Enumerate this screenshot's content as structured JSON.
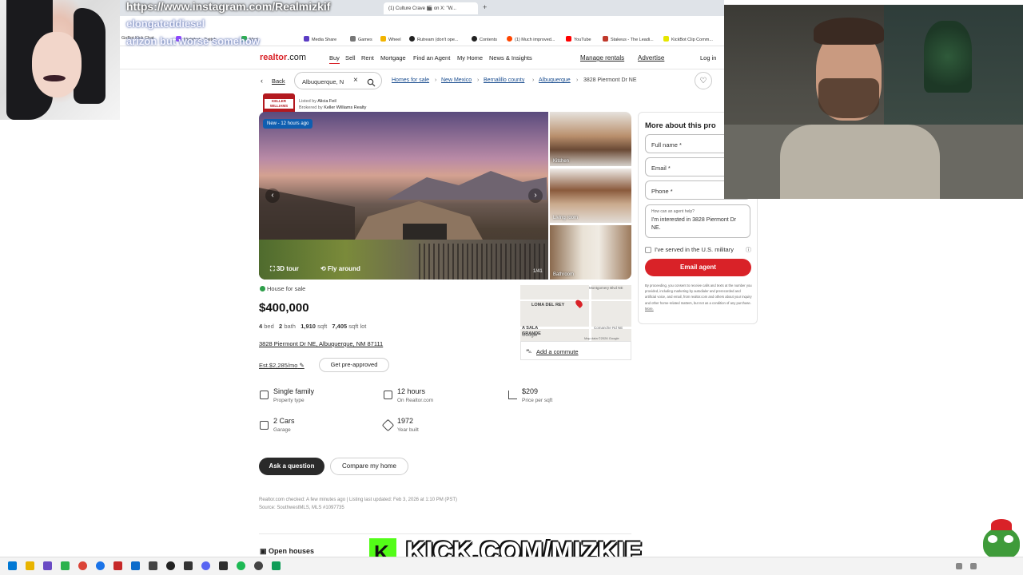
{
  "stream_overlay": {
    "url_text": "https://www.instagram.com/Realmizkif",
    "line2": "elongateddiesel",
    "line3": "arizon but worse somehow",
    "kick_text": "KICK.COM/MIZKIF"
  },
  "browser": {
    "tabs": [
      "(1) Culture Crave 🎬 on X: \"W..."
    ],
    "new_tab": "+",
    "bookmarks": [
      "GoBot Kick Chat",
      "Nightbot - Twitch",
      "Mod",
      "Media Share",
      "Games",
      "Wheel",
      "Rutream (don't ope...",
      "Contents",
      "(1) Much improved...",
      "YouTube",
      "Stakeus - The Leadi...",
      "KickBot Clip Comm..."
    ]
  },
  "header": {
    "logo_text": "realtor",
    "logo_suffix": ".com",
    "nav": [
      "Buy",
      "Sell",
      "Rent",
      "Mortgage",
      "Find an Agent",
      "My Home",
      "News & Insights"
    ],
    "manage_rentals": "Manage rentals",
    "advertise": "Advertise",
    "login": "Log in"
  },
  "search": {
    "back": "Back",
    "value": "Albuquerque, N",
    "breadcrumbs": [
      "Homes for sale",
      "New Mexico",
      "Bernalillo county",
      "Albuquerque"
    ],
    "current": "3828 Piermont Dr NE"
  },
  "agent": {
    "listed_by_label": "Listed by",
    "listed_by": "Alicia Feil",
    "brokered_by_label": "Brokered by",
    "brokered_by": "Keller Williams Realty",
    "logo_text": "KELLER WILLIAMS"
  },
  "gallery": {
    "badge": "New - 12 hours ago",
    "tour": "3D tour",
    "fly": "Fly around",
    "counter": "1/41",
    "thumbs": [
      "Kitchen",
      "Living room",
      "Bathroom"
    ]
  },
  "listing": {
    "status": "House for sale",
    "status_color": "#2e9e4a",
    "price": "$400,000",
    "beds": "4",
    "beds_label": "bed",
    "baths": "2",
    "baths_label": "bath",
    "sqft": "1,910",
    "sqft_label": "sqft",
    "lot": "7,405",
    "lot_label": "sqft lot",
    "address": "3828 Piermont Dr NE, Albuquerque, NM 87111",
    "estimate": "Est.$2,285/mo",
    "preapproved": "Get pre-approved"
  },
  "facts": [
    {
      "title": "Single family",
      "sub": "Property type"
    },
    {
      "title": "12 hours",
      "sub": "On Realtor.com"
    },
    {
      "title": "$209",
      "sub": "Price per sqft"
    },
    {
      "title": "2 Cars",
      "sub": "Garage"
    },
    {
      "title": "1972",
      "sub": "Year built"
    }
  ],
  "actions": {
    "ask": "Ask a question",
    "compare": "Compare my home"
  },
  "footer": {
    "checked": "Realtor.com checked: A few minutes ago | Listing last updated: Feb 3, 2026 at 1:10 PM (PST)",
    "source": "Source: SouthwestMLS, MLS #1097735",
    "open_houses": "Open houses"
  },
  "map": {
    "label1": "LOMA DEL REY",
    "label2": "A SALA GRANDE",
    "road1": "Montgomery Blvd NE",
    "road2": "Comanche Rd NE",
    "road3": "Eubank Blvd NE",
    "credit": "Map data ©2026 Google",
    "google": "Google",
    "commute": "Add a commute"
  },
  "contact_form": {
    "title": "More about this pro",
    "full_name": "Full name *",
    "email": "Email *",
    "phone": "Phone *",
    "help_label": "How can an agent help?",
    "message": "I'm interested in 3828 Piermont Dr NE.",
    "military": "I've served in the U.S. military",
    "submit": "Email agent",
    "submit_color": "#d92228",
    "disclaimer": "By proceeding, you consent to receive calls and texts at the number you provided, including marketing by autodialer and prerecorded and artificial voice, and email, from realtor.com and others about your inquiry and other home-related matters, but not as a condition of any purchase.",
    "more": "More."
  }
}
